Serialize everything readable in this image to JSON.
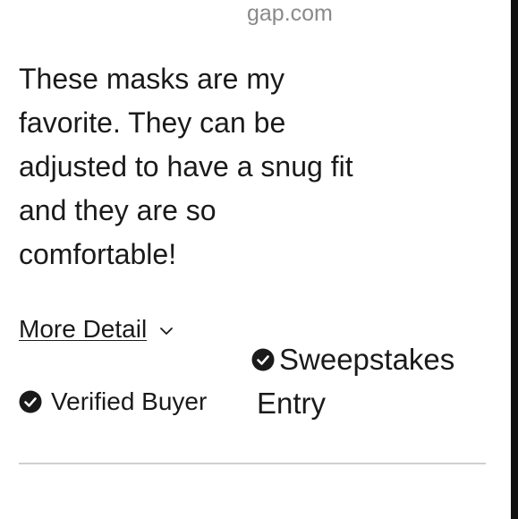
{
  "review": {
    "source": "gap.com",
    "text": "These masks are my favorite. They can be adjusted to have a snug fit and they are so comfortable!",
    "more_detail_label": "More Detail",
    "badges": {
      "verified_buyer": "Verified Buyer",
      "sweepstakes_line1": "Sweepstakes",
      "sweepstakes_line2": "Entry"
    }
  },
  "icons": {
    "check": "check-circle-icon",
    "chevron": "chevron-down-icon"
  },
  "colors": {
    "text": "#1a1a1a",
    "source_text": "#8a8a8a",
    "divider": "#cfcfcf",
    "badge_fill": "#1a1a1a"
  }
}
